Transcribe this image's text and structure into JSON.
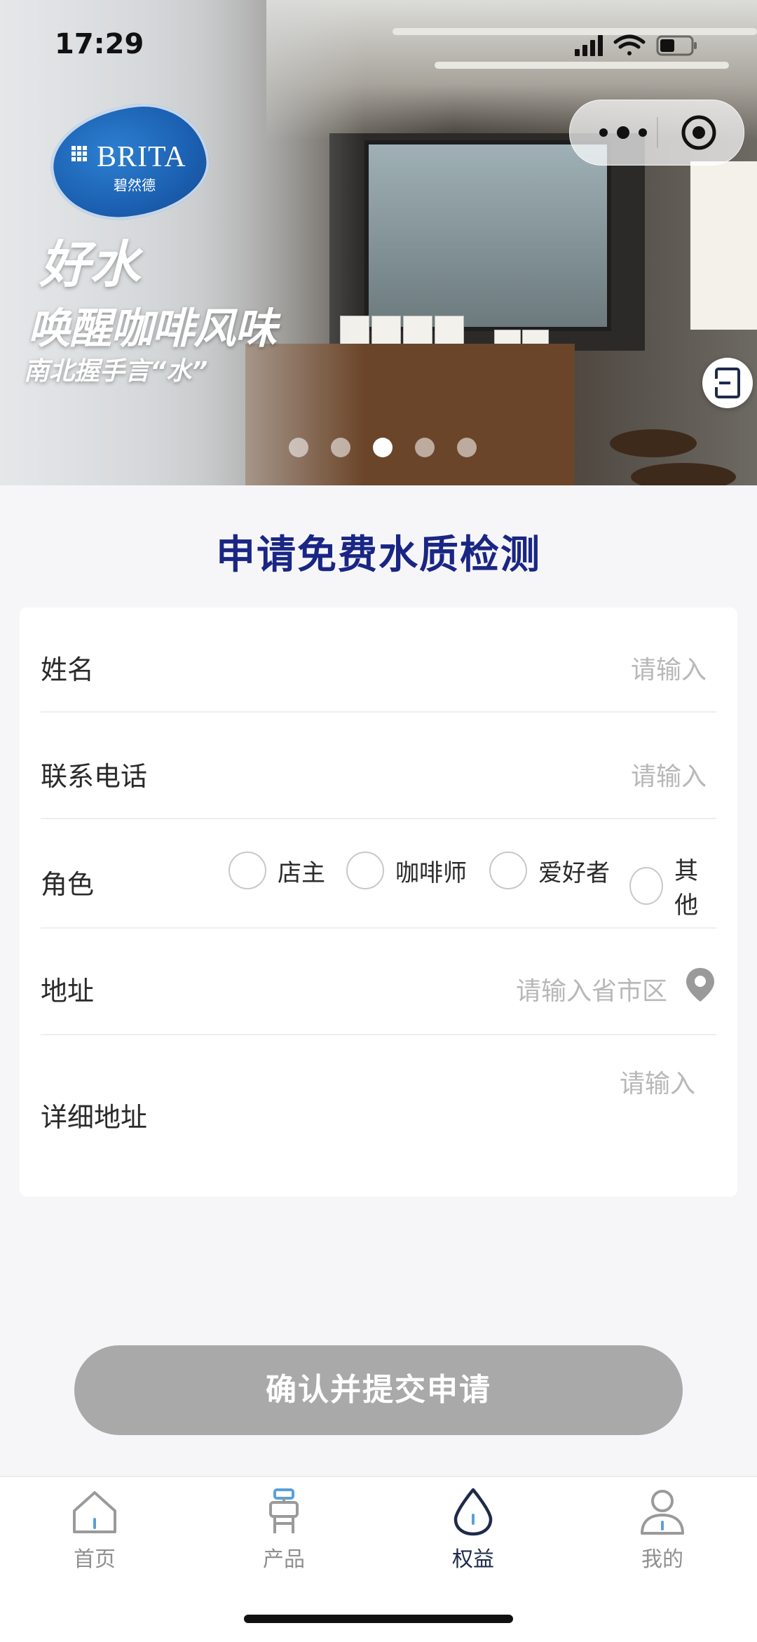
{
  "status_bar": {
    "time": "17:29"
  },
  "banner": {
    "brand": "BRITA",
    "brand_sub": "碧然德",
    "slogan_line1": "好水",
    "slogan_line2": "唤醒咖啡风味",
    "slogan_line3": "南北握手言“水”",
    "slide_count": 5,
    "active_slide": 3
  },
  "form": {
    "title": "申请免费水质检测",
    "fields": {
      "name": {
        "label": "姓名",
        "placeholder": "请输入"
      },
      "phone": {
        "label": "联系电话",
        "placeholder": "请输入"
      },
      "role": {
        "label": "角色",
        "options": [
          "店主",
          "咖啡师",
          "爱好者",
          "其他"
        ],
        "selected": null
      },
      "region": {
        "label": "地址",
        "placeholder": "请输入省市区"
      },
      "address_detail": {
        "label": "详细地址",
        "placeholder": "请输入"
      }
    },
    "submit_label": "确认并提交申请"
  },
  "tabbar": {
    "items": [
      {
        "label": "首页",
        "icon": "home-icon"
      },
      {
        "label": "产品",
        "icon": "product-icon"
      },
      {
        "label": "权益",
        "icon": "benefits-drop-icon"
      },
      {
        "label": "我的",
        "icon": "profile-icon"
      }
    ],
    "active": 2
  },
  "colors": {
    "title": "#1a2684",
    "submit_disabled": "#a9a9a9",
    "tab_active": "#1f2a4a",
    "tab_inactive": "#8f8f8f",
    "accent_blue": "#5aa0d8"
  }
}
